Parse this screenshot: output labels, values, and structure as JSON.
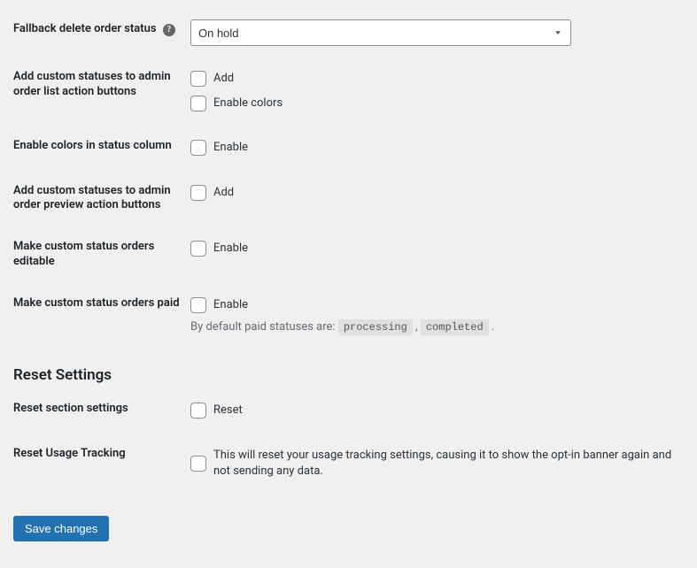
{
  "fields": {
    "fallback": {
      "label": "Fallback delete order status",
      "value": "On hold"
    },
    "admin_list_buttons": {
      "label": "Add custom statuses to admin order list action buttons",
      "check1": "Add",
      "check2": "Enable colors"
    },
    "status_column_colors": {
      "label": "Enable colors in status column",
      "check1": "Enable"
    },
    "preview_buttons": {
      "label": "Add custom statuses to admin order preview action buttons",
      "check1": "Add"
    },
    "editable": {
      "label": "Make custom status orders editable",
      "check1": "Enable"
    },
    "paid": {
      "label": "Make custom status orders paid",
      "check1": "Enable",
      "desc_prefix": "By default paid statuses are: ",
      "code1": "processing",
      "sep": " , ",
      "code2": "completed",
      "suffix": " ."
    }
  },
  "reset_section": {
    "title": "Reset Settings",
    "section_settings": {
      "label": "Reset section settings",
      "check1": "Reset"
    },
    "usage_tracking": {
      "label": "Reset Usage Tracking",
      "check1": "This will reset your usage tracking settings, causing it to show the opt-in banner again and not sending any data."
    }
  },
  "submit": {
    "label": "Save changes"
  },
  "help_glyph": "?"
}
